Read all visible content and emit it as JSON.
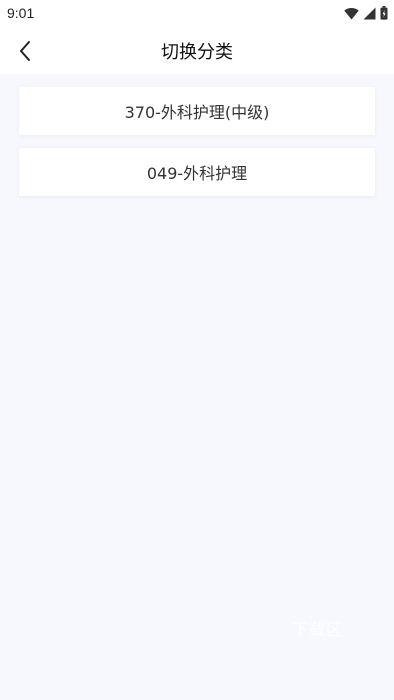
{
  "status_bar": {
    "time": "9:01",
    "icons": [
      "wifi-icon",
      "signal-icon",
      "battery-icon"
    ]
  },
  "nav": {
    "back_icon": "chevron-left-icon",
    "title": "切换分类"
  },
  "categories": [
    {
      "label": "370-外科护理(中级)"
    },
    {
      "label": "049-外科护理"
    }
  ],
  "watermark": "下载区",
  "colors": {
    "background": "#f7f8fd",
    "card": "#ffffff",
    "text": "#333333"
  }
}
